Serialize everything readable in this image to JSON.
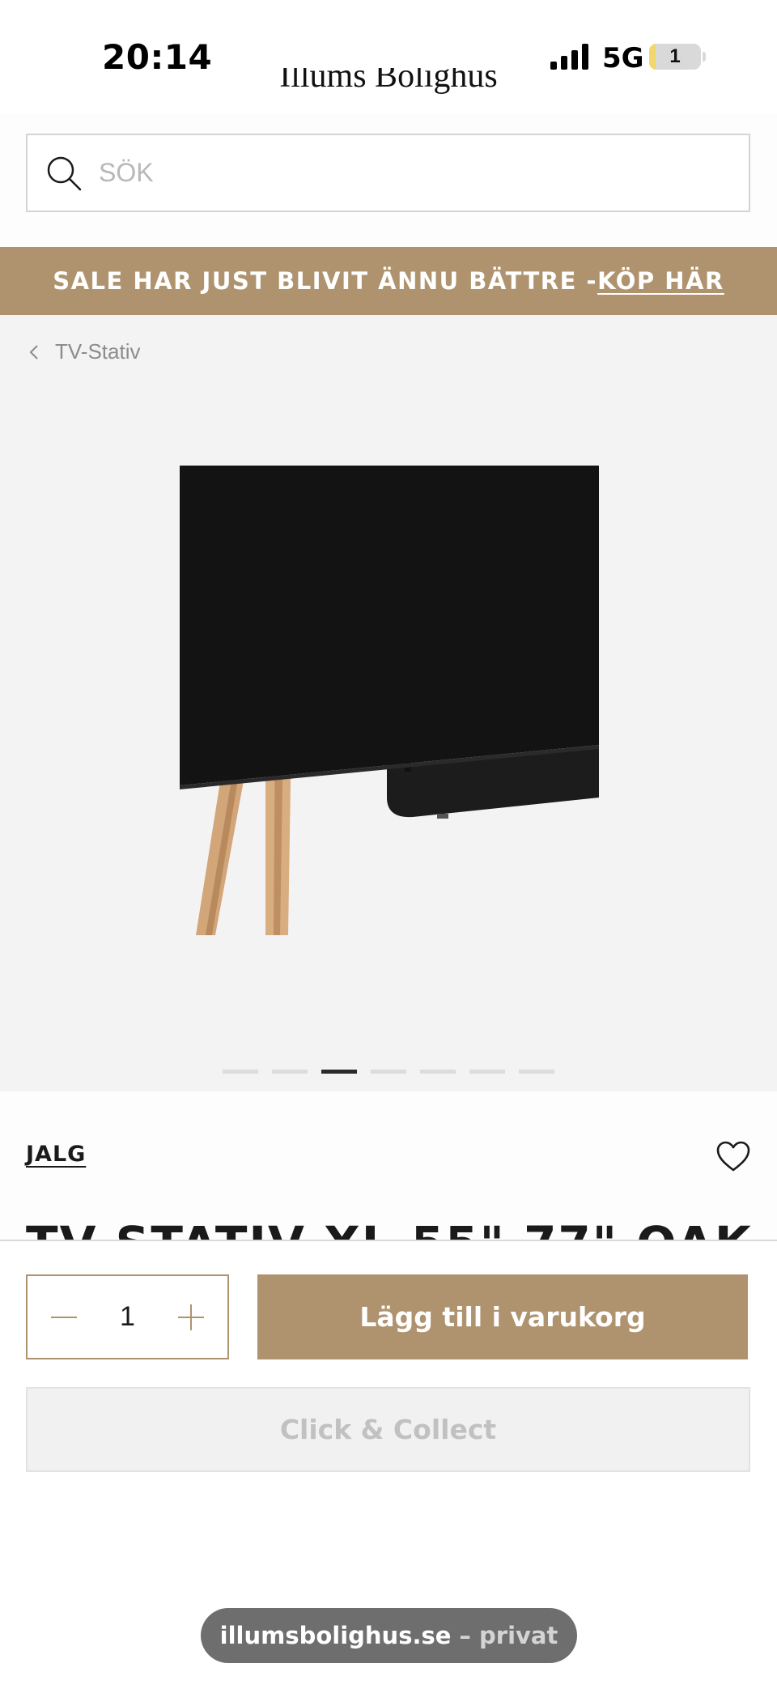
{
  "status_bar": {
    "time": "20:14",
    "network": "5G",
    "battery": "1"
  },
  "header": {
    "logo": "Illums Bolighus"
  },
  "search": {
    "placeholder": "SÖK",
    "value": ""
  },
  "promo": {
    "text": "SALE HAR JUST BLIVIT ÄNNU BÄTTRE - ",
    "link_label": "KÖP HÄR"
  },
  "gallery": {
    "breadcrumb": "TV-Stativ",
    "image_count": 7,
    "active_index": 2
  },
  "product": {
    "brand": "JALG",
    "title": "TV STATIV XL 55\" 77\" OAK"
  },
  "buy_bar": {
    "quantity": "1",
    "add_to_cart_label": "Lägg till i varukorg",
    "click_collect_label": "Click & Collect"
  },
  "browser": {
    "domain": "illumsbolighus.se",
    "mode": "– privat"
  },
  "colors": {
    "accent": "#af936e",
    "gallery_bg": "#f4f3f3",
    "disabled_text": "#c1c1c1"
  },
  "icons": [
    "signal-icon",
    "search-icon",
    "chevron-left-icon",
    "heart-icon",
    "minus-icon",
    "plus-icon"
  ]
}
